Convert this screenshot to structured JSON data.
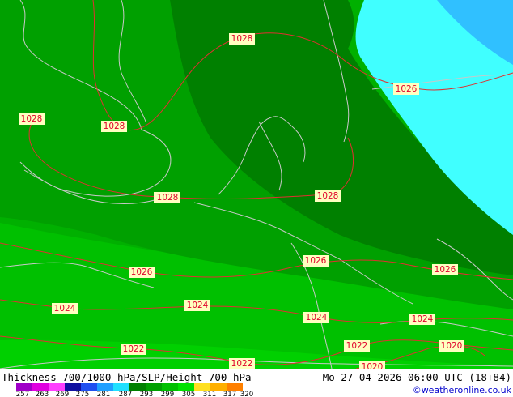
{
  "map": {
    "field": "Thickness 700/1000 hPa/SLP/Height 700 hPa",
    "valid_time": "Mo 27-04-2026 06:00 UTC (18+84)",
    "credit": "©weatheronline.co.uk"
  },
  "isobar_labels": [
    {
      "text": "1028"
    },
    {
      "text": "1028"
    },
    {
      "text": "1028"
    },
    {
      "text": "1028"
    },
    {
      "text": "1028"
    },
    {
      "text": "1026"
    },
    {
      "text": "1026"
    },
    {
      "text": "1026"
    },
    {
      "text": "1026"
    },
    {
      "text": "1024"
    },
    {
      "text": "1024"
    },
    {
      "text": "1024"
    },
    {
      "text": "1024"
    },
    {
      "text": "1022"
    },
    {
      "text": "1022"
    },
    {
      "text": "1022"
    },
    {
      "text": "1020"
    },
    {
      "text": "1020"
    },
    {
      "text": "1028"
    }
  ],
  "legend": {
    "values": [
      "257",
      "263",
      "269",
      "275",
      "281",
      "287",
      "293",
      "299",
      "305",
      "311",
      "317",
      "320"
    ],
    "colors": [
      "#a000c8",
      "#e000e0",
      "#ff40ff",
      "#1010a0",
      "#2050f0",
      "#20a0ff",
      "#20e0ff",
      "#008000",
      "#00a000",
      "#00c000",
      "#00e000",
      "#ffe020",
      "#ffb000",
      "#ff8000"
    ]
  },
  "colors": {
    "dark_green": "#008000",
    "mid_green": "#00a400",
    "light_green": "#00c000",
    "cyan": "#40ffff",
    "light_blue": "#30c0ff",
    "isobar": "#e03030",
    "coast": "#c0c0c0"
  }
}
